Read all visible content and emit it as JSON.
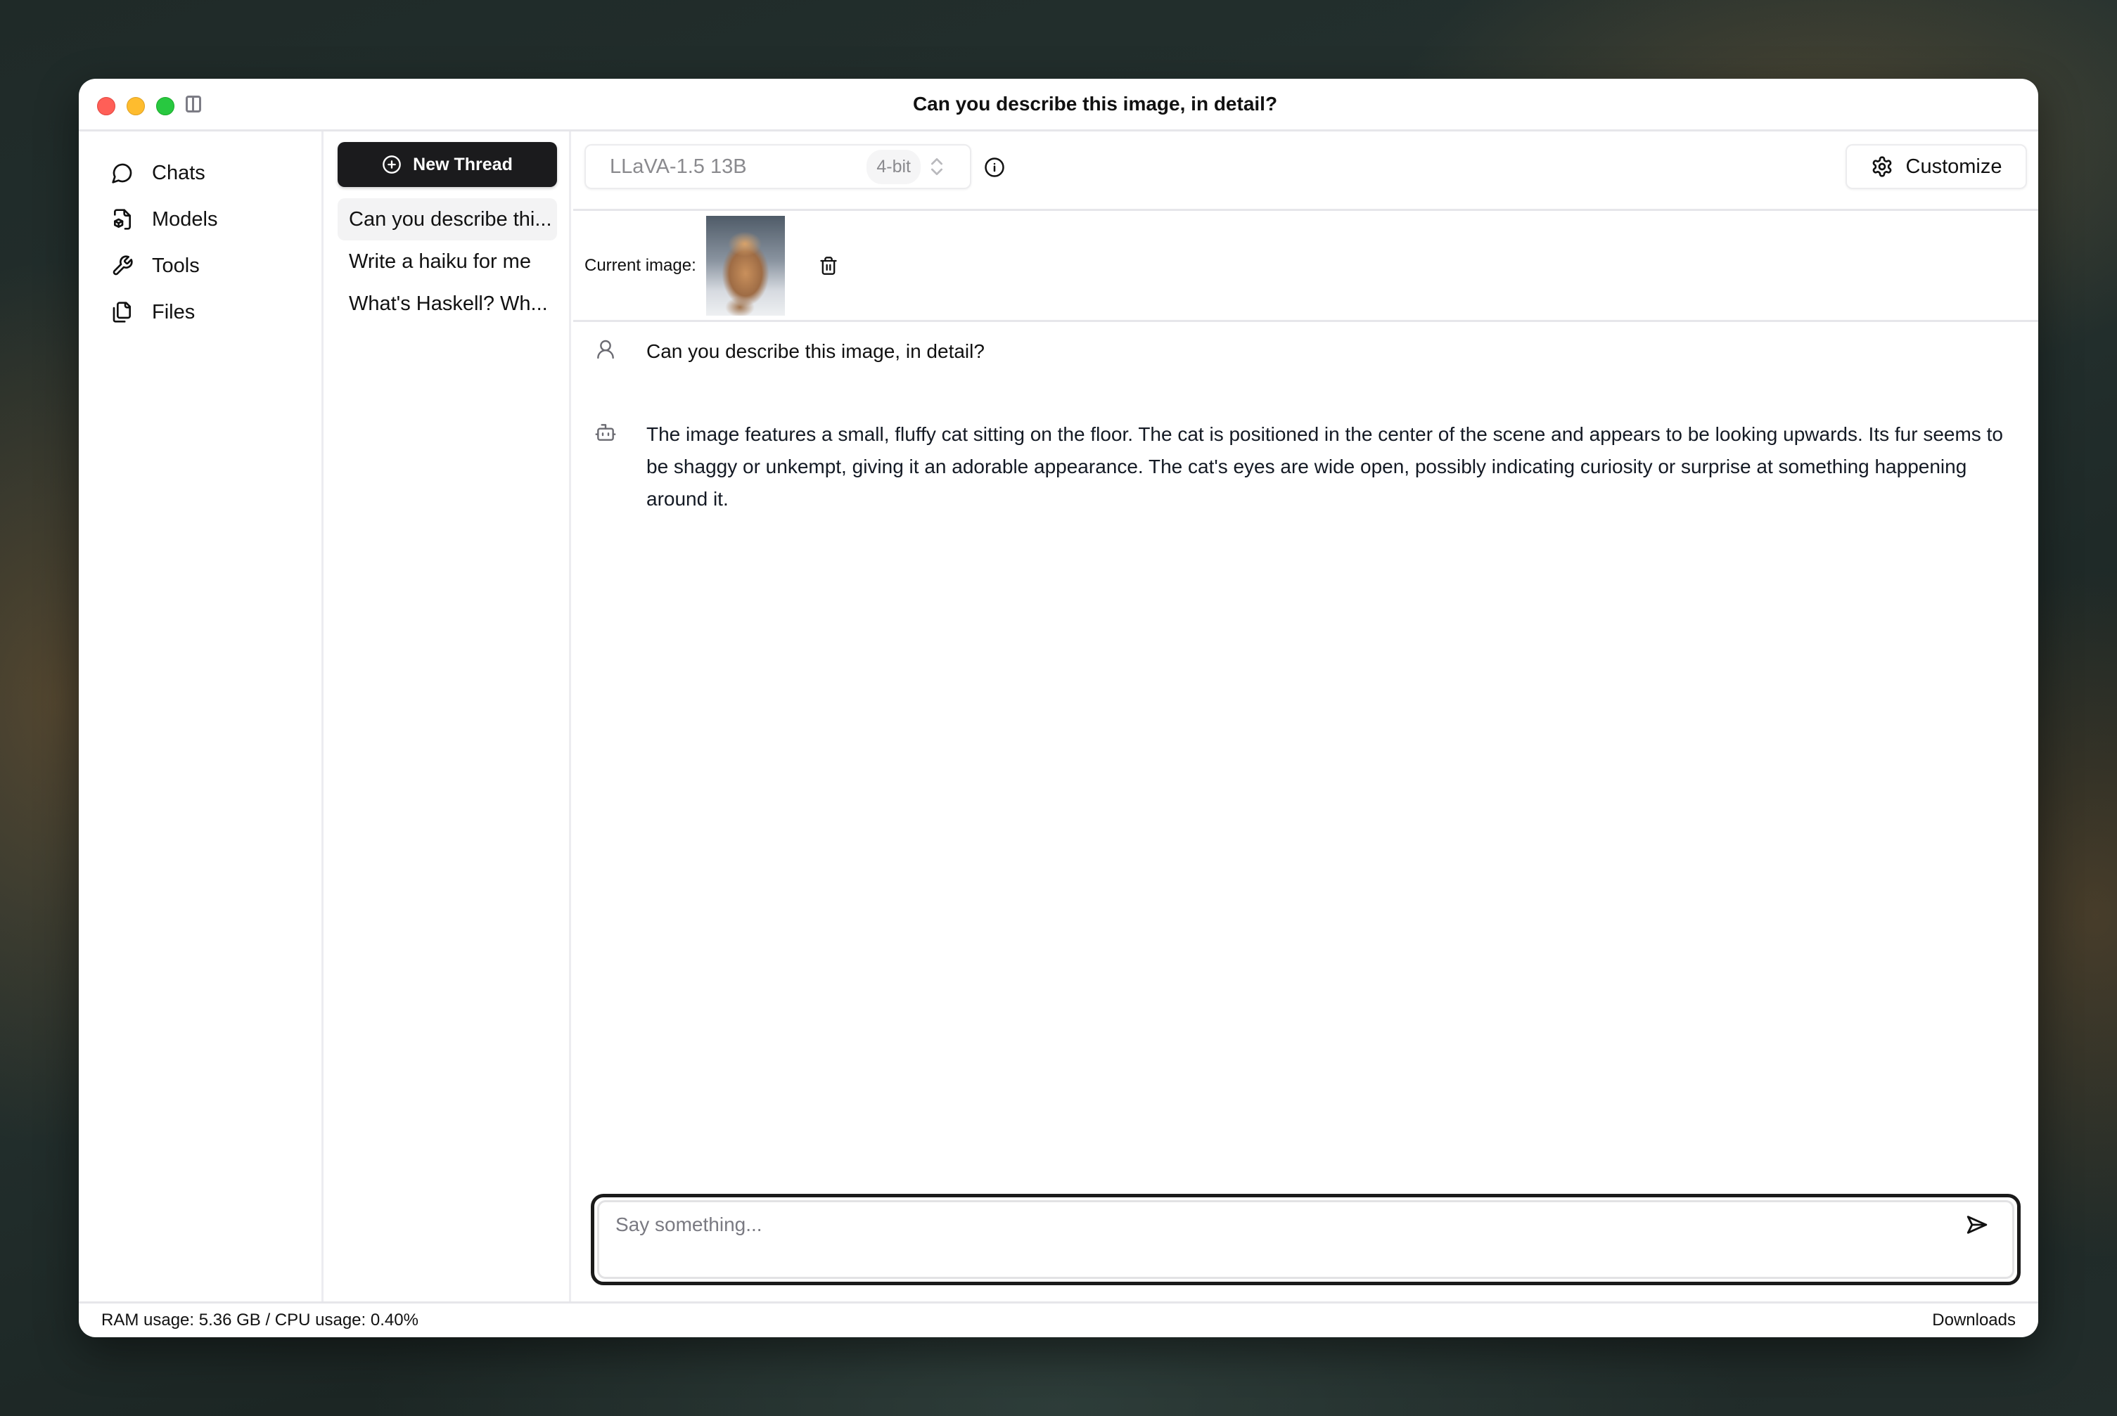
{
  "window": {
    "title": "Can you describe this image, in detail?"
  },
  "nav": {
    "items": [
      {
        "label": "Chats",
        "icon": "chat-bubble-icon"
      },
      {
        "label": "Models",
        "icon": "model-file-icon"
      },
      {
        "label": "Tools",
        "icon": "wrench-icon"
      },
      {
        "label": "Files",
        "icon": "files-icon"
      }
    ]
  },
  "threads": {
    "new_label": "New Thread",
    "items": [
      {
        "label": "Can you describe thi...",
        "active": true
      },
      {
        "label": "Write a haiku for me",
        "active": false
      },
      {
        "label": "What's Haskell? Wh...",
        "active": false
      }
    ]
  },
  "toolbar": {
    "model_name": "LLaVA-1.5 13B",
    "quantization": "4-bit",
    "customize_label": "Customize"
  },
  "image_bar": {
    "label": "Current image:"
  },
  "messages": [
    {
      "role": "user",
      "text": "Can you describe this image, in detail?"
    },
    {
      "role": "assistant",
      "text": "The image features a small, fluffy cat sitting on the floor. The cat is positioned in the center of the scene and appears to be looking upwards. Its fur seems to be shaggy or unkempt, giving it an adorable appearance. The cat's eyes are wide open, possibly indicating curiosity or surprise at something happening around it."
    }
  ],
  "composer": {
    "placeholder": "Say something...",
    "value": ""
  },
  "status": {
    "resources": "RAM usage: 5.36 GB / CPU usage: 0.40%",
    "downloads_label": "Downloads"
  },
  "colors": {
    "close": "#ff5f57",
    "minimize": "#febc2e",
    "maximize": "#28c840",
    "primary_button": "#1b1b1d",
    "active_thread_bg": "#f3f3f4"
  }
}
